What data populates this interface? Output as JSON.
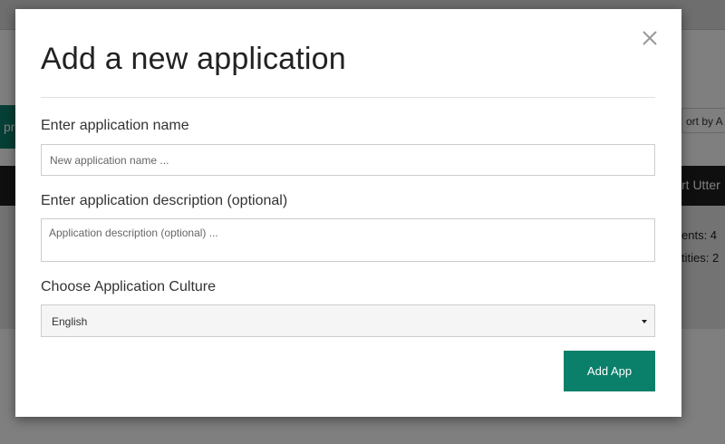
{
  "background": {
    "teal_button_fragment": "pr",
    "sort_fragment": "ort by A",
    "darkband_fragment": "rt Utter",
    "stat_intents": "ents: 4",
    "stat_entities": "tities: 2"
  },
  "modal": {
    "title": "Add a new application",
    "close_icon": "close-icon",
    "name_label": "Enter application name",
    "name_placeholder": "New application name ...",
    "description_label": "Enter application description (optional)",
    "description_placeholder": "Application description (optional) ...",
    "culture_label": "Choose Application Culture",
    "culture_selected": "English",
    "submit_label": "Add App"
  },
  "colors": {
    "accent": "#0a7f6a",
    "overlay": "#000000"
  }
}
